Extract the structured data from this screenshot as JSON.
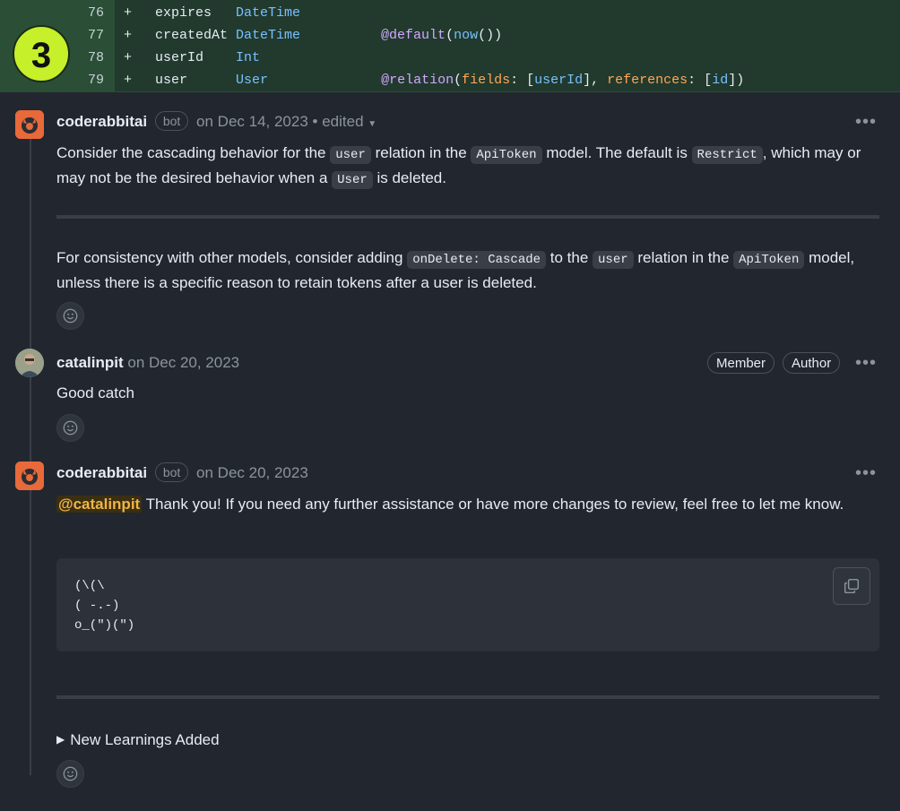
{
  "step_badge": "3",
  "diff": {
    "lines": [
      {
        "number": "76",
        "sign": "+",
        "tokens": [
          {
            "t": "expires   ",
            "c": "plain"
          },
          {
            "t": "DateTime",
            "c": "type"
          }
        ]
      },
      {
        "number": "77",
        "sign": "+",
        "tokens": [
          {
            "t": "createdAt ",
            "c": "plain"
          },
          {
            "t": "DateTime",
            "c": "type"
          },
          {
            "t": "          ",
            "c": "plain"
          },
          {
            "t": "@default",
            "c": "attr"
          },
          {
            "t": "(",
            "c": "plain"
          },
          {
            "t": "now",
            "c": "type"
          },
          {
            "t": "())",
            "c": "plain"
          }
        ]
      },
      {
        "number": "78",
        "sign": "+",
        "tokens": [
          {
            "t": "userId    ",
            "c": "plain"
          },
          {
            "t": "Int",
            "c": "type"
          }
        ]
      },
      {
        "number": "79",
        "sign": "+",
        "tokens": [
          {
            "t": "user      ",
            "c": "plain"
          },
          {
            "t": "User",
            "c": "type"
          },
          {
            "t": "              ",
            "c": "plain"
          },
          {
            "t": "@relation",
            "c": "attr"
          },
          {
            "t": "(",
            "c": "plain"
          },
          {
            "t": "fields",
            "c": "key"
          },
          {
            "t": ": [",
            "c": "plain"
          },
          {
            "t": "userId",
            "c": "type"
          },
          {
            "t": "], ",
            "c": "plain"
          },
          {
            "t": "references",
            "c": "key"
          },
          {
            "t": ": [",
            "c": "plain"
          },
          {
            "t": "id",
            "c": "type"
          },
          {
            "t": "])",
            "c": "plain"
          }
        ]
      }
    ]
  },
  "comments": [
    {
      "author": "coderabbitai",
      "bot_label": "bot",
      "date": "on Dec 14, 2023",
      "edited": "• edited",
      "para1": [
        {
          "t": "Consider the cascading behavior for the "
        },
        {
          "code": "user"
        },
        {
          "t": " relation in the "
        },
        {
          "code": "ApiToken"
        },
        {
          "t": " model. The default is "
        },
        {
          "code": "Restrict"
        },
        {
          "t": ", which may or may not be the desired behavior when a "
        },
        {
          "code": "User"
        },
        {
          "t": " is deleted."
        }
      ],
      "para2": [
        {
          "t": "For consistency with other models, consider adding "
        },
        {
          "code": "onDelete: Cascade"
        },
        {
          "t": " to the "
        },
        {
          "code": "user"
        },
        {
          "t": " relation in the "
        },
        {
          "code": "ApiToken"
        },
        {
          "t": " model, unless there is a specific reason to retain tokens after a user is deleted."
        }
      ]
    },
    {
      "author": "catalinpit",
      "date": "on Dec 20, 2023",
      "role_member": "Member",
      "role_author": "Author",
      "body": "Good catch"
    },
    {
      "author": "coderabbitai",
      "bot_label": "bot",
      "date": "on Dec 20, 2023",
      "mention": "@catalinpit",
      "body": " Thank you! If you need any further assistance or have more changes to review, feel free to let me know.",
      "code_block": "(\\(\\\n( -.-)\no_(\")(\")",
      "details_summary": "New Learnings Added"
    }
  ],
  "more_label": "•••",
  "colors": {
    "accent_badge": "#c5f02a",
    "bot_avatar": "#e8693a",
    "mention": "#f0b543"
  }
}
